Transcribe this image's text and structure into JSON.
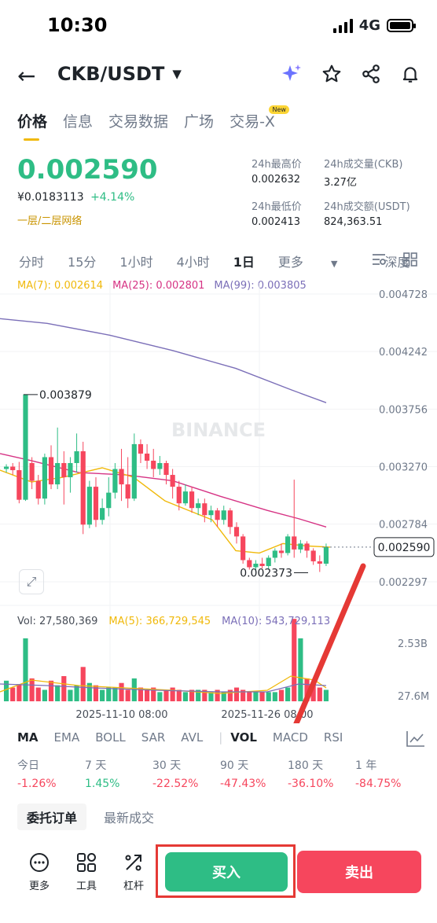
{
  "status": {
    "time": "10:30",
    "network": "4G"
  },
  "header": {
    "pair": "CKB/USDT"
  },
  "tabs": [
    "价格",
    "信息",
    "交易数据",
    "广场",
    "交易-X"
  ],
  "tab_badge": "New",
  "price": {
    "last": "0.002590",
    "fiat": "¥0.0183113",
    "change": "+4.14%",
    "network": "一层/二层网络"
  },
  "stats": [
    {
      "label": "24h最高价",
      "value": "0.002632"
    },
    {
      "label": "24h成交量(CKB)",
      "value": "3.27亿"
    },
    {
      "label": "24h最低价",
      "value": "0.002413"
    },
    {
      "label": "24h成交额(USDT)",
      "value": "824,363.51"
    }
  ],
  "intervals": [
    "分时",
    "15分",
    "1小时",
    "4小时",
    "1日",
    "更多",
    "深度"
  ],
  "ma_legend": [
    {
      "text": "MA(7): 0.002614",
      "color": "#f0b90b"
    },
    {
      "text": "MA(25): 0.002801",
      "color": "#d63384"
    },
    {
      "text": "MA(99): 0.003805",
      "color": "#7b6fb8"
    }
  ],
  "watermark": "BINANCE",
  "chart_data": {
    "type": "candlestick",
    "y_ticks": [
      "0.004728",
      "0.004242",
      "0.003756",
      "0.003270",
      "0.002784",
      "0.002590",
      "0.002297"
    ],
    "ylim": [
      0.002297,
      0.004728
    ],
    "current_price": "0.002590",
    "high_marker": "0.003879",
    "low_marker": "0.002373",
    "x_ticks": [
      "2025-11-10 08:00",
      "2025-11-26 08:00"
    ],
    "candles": [
      [
        0.00325,
        0.00327,
        0.00322,
        0.00329
      ],
      [
        0.00327,
        0.00324,
        0.0032,
        0.0033
      ],
      [
        0.00324,
        0.00299,
        0.00296,
        0.00331
      ],
      [
        0.00299,
        0.00388,
        0.00298,
        0.00388
      ],
      [
        0.0033,
        0.00315,
        0.00308,
        0.00335
      ],
      [
        0.00315,
        0.003,
        0.00295,
        0.0032
      ],
      [
        0.003,
        0.00335,
        0.00295,
        0.00338
      ],
      [
        0.00335,
        0.00312,
        0.00308,
        0.00345
      ],
      [
        0.00312,
        0.0033,
        0.00308,
        0.0036
      ],
      [
        0.0033,
        0.00318,
        0.00295,
        0.0034
      ],
      [
        0.00318,
        0.0033,
        0.00305,
        0.00335
      ],
      [
        0.0033,
        0.0034,
        0.00322,
        0.00355
      ],
      [
        0.0034,
        0.00278,
        0.0027,
        0.00348
      ],
      [
        0.00278,
        0.0031,
        0.00275,
        0.00315
      ],
      [
        0.0031,
        0.00282,
        0.00276,
        0.00318
      ],
      [
        0.00282,
        0.00292,
        0.00278,
        0.003
      ],
      [
        0.00292,
        0.00305,
        0.00285,
        0.00318
      ],
      [
        0.00305,
        0.00325,
        0.003,
        0.0033
      ],
      [
        0.00325,
        0.00312,
        0.00298,
        0.00342
      ],
      [
        0.00312,
        0.003,
        0.00292,
        0.00335
      ],
      [
        0.003,
        0.00346,
        0.00298,
        0.00355
      ],
      [
        0.00346,
        0.00338,
        0.0033,
        0.0035
      ],
      [
        0.00338,
        0.00332,
        0.00325,
        0.00346
      ],
      [
        0.00332,
        0.00325,
        0.00318,
        0.00342
      ],
      [
        0.00325,
        0.0033,
        0.0032,
        0.00336
      ],
      [
        0.0033,
        0.0032,
        0.00312,
        0.00332
      ],
      [
        0.0032,
        0.0031,
        0.003,
        0.00325
      ],
      [
        0.0031,
        0.00296,
        0.0029,
        0.00315
      ],
      [
        0.00296,
        0.00306,
        0.00294,
        0.00312
      ],
      [
        0.00306,
        0.00292,
        0.00288,
        0.0031
      ],
      [
        0.00292,
        0.00296,
        0.00286,
        0.003
      ],
      [
        0.00296,
        0.00286,
        0.0028,
        0.003
      ],
      [
        0.00286,
        0.0029,
        0.0028,
        0.00294
      ],
      [
        0.0029,
        0.00282,
        0.00276,
        0.00292
      ],
      [
        0.00282,
        0.0029,
        0.00278,
        0.00294
      ],
      [
        0.0029,
        0.00276,
        0.0027,
        0.00292
      ],
      [
        0.00276,
        0.00268,
        0.00262,
        0.0028
      ],
      [
        0.00268,
        0.00248,
        0.00245,
        0.0027
      ],
      [
        0.00248,
        0.00242,
        0.0024,
        0.0025
      ],
      [
        0.00242,
        0.00245,
        0.00238,
        0.00248
      ],
      [
        0.00245,
        0.00243,
        0.00241,
        0.0025
      ],
      [
        0.00243,
        0.0025,
        0.0024,
        0.00252
      ],
      [
        0.0025,
        0.00256,
        0.00246,
        0.00258
      ],
      [
        0.00256,
        0.00254,
        0.0025,
        0.00262
      ],
      [
        0.00254,
        0.00268,
        0.00252,
        0.0027
      ],
      [
        0.00268,
        0.00257,
        0.0025,
        0.00316
      ],
      [
        0.00257,
        0.00262,
        0.00254,
        0.00265
      ],
      [
        0.00262,
        0.00256,
        0.0025,
        0.00264
      ],
      [
        0.00256,
        0.00247,
        0.00244,
        0.00258
      ],
      [
        0.00247,
        0.00245,
        0.00238,
        0.00252
      ],
      [
        0.00245,
        0.00259,
        0.00243,
        0.00262
      ]
    ],
    "ma_lines": {
      "ma99": [
        [
          0,
          0.00452
        ],
        [
          60,
          0.00448
        ],
        [
          140,
          0.00438
        ],
        [
          220,
          0.00425
        ],
        [
          300,
          0.0041
        ],
        [
          370,
          0.00392
        ],
        [
          415,
          0.00381
        ]
      ],
      "ma25": [
        [
          0,
          0.00338
        ],
        [
          40,
          0.00332
        ],
        [
          100,
          0.00322
        ],
        [
          160,
          0.0032
        ],
        [
          220,
          0.00315
        ],
        [
          280,
          0.00302
        ],
        [
          340,
          0.0029
        ],
        [
          380,
          0.00283
        ],
        [
          415,
          0.00276
        ]
      ],
      "ma7": [
        [
          0,
          0.00324
        ],
        [
          40,
          0.00314
        ],
        [
          80,
          0.00318
        ],
        [
          130,
          0.00326
        ],
        [
          170,
          0.00318
        ],
        [
          210,
          0.00298
        ],
        [
          240,
          0.0029
        ],
        [
          270,
          0.00282
        ],
        [
          300,
          0.00256
        ],
        [
          330,
          0.00254
        ],
        [
          360,
          0.00262
        ],
        [
          390,
          0.0026
        ],
        [
          420,
          0.00259
        ]
      ]
    },
    "volume_ticks": [
      "2.53B",
      "27.6M"
    ],
    "volume": [
      0.18,
      0.12,
      0.15,
      0.55,
      0.2,
      0.12,
      0.1,
      0.18,
      0.14,
      0.22,
      0.1,
      0.14,
      0.3,
      0.16,
      0.14,
      0.1,
      0.12,
      0.12,
      0.16,
      0.1,
      0.2,
      0.12,
      0.1,
      0.12,
      0.08,
      0.1,
      0.12,
      0.1,
      0.08,
      0.1,
      0.1,
      0.1,
      0.08,
      0.1,
      0.08,
      0.1,
      0.12,
      0.1,
      0.08,
      0.08,
      0.08,
      0.08,
      0.08,
      0.1,
      0.12,
      0.72,
      0.55,
      0.2,
      0.16,
      0.12,
      0.1
    ]
  },
  "vol_legend": [
    {
      "text": "Vol: 27,580,369",
      "color": "#474d57"
    },
    {
      "text": "MA(5): 366,729,545",
      "color": "#f0b90b"
    },
    {
      "text": "MA(10): 543,729,113",
      "color": "#7b6fb8"
    }
  ],
  "indicators": [
    "MA",
    "EMA",
    "BOLL",
    "SAR",
    "AVL",
    "VOL",
    "MACD",
    "RSI"
  ],
  "performance": [
    {
      "label": "今日",
      "value": "-1.26%"
    },
    {
      "label": "7 天",
      "value": "1.45%"
    },
    {
      "label": "30 天",
      "value": "-22.52%"
    },
    {
      "label": "90 天",
      "value": "-47.43%"
    },
    {
      "label": "180 天",
      "value": "-36.10%"
    },
    {
      "label": "1 年",
      "value": "-84.75%"
    }
  ],
  "order_tabs": [
    "委托订单",
    "最新成交"
  ],
  "bottom": {
    "more": "更多",
    "tools": "工具",
    "leverage": "杠杆",
    "buy": "买入",
    "sell": "卖出"
  }
}
